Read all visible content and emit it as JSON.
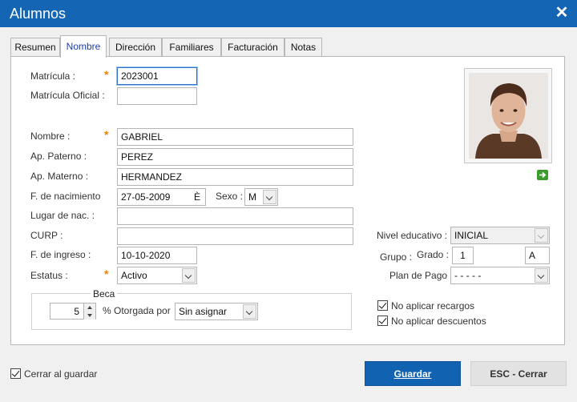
{
  "window": {
    "title": "Alumnos",
    "close_glyph": "✕"
  },
  "tabs": [
    {
      "label": "Resumen"
    },
    {
      "label": "Nombre"
    },
    {
      "label": "Dirección"
    },
    {
      "label": "Familiares"
    },
    {
      "label": "Facturación"
    },
    {
      "label": "Notas"
    }
  ],
  "active_tab": "Nombre",
  "form": {
    "matricula": {
      "label": "Matrícula :",
      "value": "2023001",
      "required": true
    },
    "matricula_oficial": {
      "label": "Matrícula Oficial :",
      "value": ""
    },
    "nombre": {
      "label": "Nombre :",
      "value": "GABRIEL",
      "required": true
    },
    "ap_paterno": {
      "label": "Ap. Paterno :",
      "value": "PEREZ"
    },
    "ap_materno": {
      "label": "Ap. Materno :",
      "value": "HERMANDEZ"
    },
    "f_nacimiento": {
      "label": "F. de nacimiento",
      "value": "27-05-2009",
      "picker_glyph": "È"
    },
    "sexo": {
      "label": "Sexo :",
      "value": "M"
    },
    "lugar_nac": {
      "label": "Lugar de nac. :",
      "value": ""
    },
    "curp": {
      "label": "CURP :",
      "value": ""
    },
    "f_ingreso": {
      "label": "F. de ingreso :",
      "value": "10-10-2020"
    },
    "estatus": {
      "label": "Estatus :",
      "value": "Activo",
      "required": true
    },
    "required_mark": "*"
  },
  "beca": {
    "legend": "Beca",
    "percent_value": "5",
    "percent_label": "%",
    "otorgada_label": "Otorgada por",
    "otorgada_value": "Sin asignar"
  },
  "right": {
    "nivel_educativo": {
      "label": "Nivel educativo :",
      "value": "INICIAL"
    },
    "grupo": {
      "label": "Grupo :",
      "grado_label": "Grado :",
      "grado_value": "1",
      "grupo_value": "A"
    },
    "plan_pago": {
      "label": "Plan de Pago",
      "value": "- - - - -"
    },
    "no_aplicar_recargos": {
      "label": "No aplicar recargos",
      "checked": true
    },
    "no_aplicar_descuentos": {
      "label": "No aplicar descuentos",
      "checked": true
    }
  },
  "photo": {
    "icon": "student-photo",
    "arrow_icon": "green-arrow-icon"
  },
  "footer": {
    "cerrar_al_guardar": {
      "label": "Cerrar al guardar",
      "checked": true
    },
    "save_button": "Guardar",
    "close_button": "ESC - Cerrar"
  },
  "colors": {
    "titlebar": "#1565b5",
    "primary_button": "#1262b2",
    "required_mark": "#f08000",
    "active_tab_text": "#1a3fb5"
  }
}
